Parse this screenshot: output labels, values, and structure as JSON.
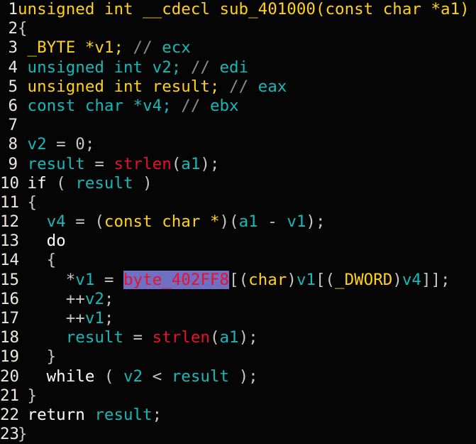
{
  "view": {
    "name": "pseudocode-view",
    "background": "#050505",
    "font_size_px": 22.5,
    "line_height_px": 27.2,
    "total_lines": 23,
    "function_name": "sub_401000",
    "selected_token": "byte_402FF8"
  },
  "colors": {
    "background": "#050505",
    "line_number": "#ede8de",
    "punctuation": "#c6c6c6",
    "keyword": "#ffffff",
    "type": "#ffd11a",
    "variable": "#18b8b8",
    "function_call": "#e8112d",
    "comment": "#8c8c8c",
    "comment_register": "#18b8b8",
    "highlight_background": "#6f6fc4",
    "highlight_text": "#e8112d"
  },
  "lines": [
    {
      "number": "1",
      "tokens": [
        {
          "text": "unsigned int __cdecl sub_401000(const char *a1)",
          "style": "t-type"
        }
      ]
    },
    {
      "number": "2",
      "tokens": [
        {
          "text": "{",
          "style": "t-punct"
        }
      ]
    },
    {
      "number": "3",
      "tokens": [
        {
          "text": " _BYTE *v1;",
          "style": "t-type"
        },
        {
          "text": " // ",
          "style": "t-comment"
        },
        {
          "text": "ecx",
          "style": "t-comreg"
        }
      ]
    },
    {
      "number": "4",
      "tokens": [
        {
          "text": " unsigned int v2;",
          "style": "t-var"
        },
        {
          "text": " // ",
          "style": "t-comment"
        },
        {
          "text": "edi",
          "style": "t-comreg"
        }
      ]
    },
    {
      "number": "5",
      "tokens": [
        {
          "text": " unsigned int result;",
          "style": "t-type"
        },
        {
          "text": " // ",
          "style": "t-comment"
        },
        {
          "text": "eax",
          "style": "t-comreg"
        }
      ]
    },
    {
      "number": "6",
      "tokens": [
        {
          "text": " const char *v4;",
          "style": "t-var"
        },
        {
          "text": " // ",
          "style": "t-comment"
        },
        {
          "text": "ebx",
          "style": "t-comreg"
        }
      ]
    },
    {
      "number": "7",
      "tokens": [
        {
          "text": "",
          "style": "t-plain"
        }
      ]
    },
    {
      "number": "8",
      "tokens": [
        {
          "text": " ",
          "style": "t-plain"
        },
        {
          "text": "v2",
          "style": "t-var"
        },
        {
          "text": " = ",
          "style": "t-punct"
        },
        {
          "text": "0",
          "style": "t-number"
        },
        {
          "text": ";",
          "style": "t-punct"
        }
      ]
    },
    {
      "number": "9",
      "tokens": [
        {
          "text": " ",
          "style": "t-plain"
        },
        {
          "text": "result",
          "style": "t-var"
        },
        {
          "text": " = ",
          "style": "t-punct"
        },
        {
          "text": "strlen",
          "style": "t-func"
        },
        {
          "text": "(",
          "style": "t-punct"
        },
        {
          "text": "a1",
          "style": "t-var"
        },
        {
          "text": ");",
          "style": "t-punct"
        }
      ]
    },
    {
      "number": "10",
      "tokens": [
        {
          "text": " ",
          "style": "t-plain"
        },
        {
          "text": "if",
          "style": "t-keyword"
        },
        {
          "text": " ( ",
          "style": "t-punct"
        },
        {
          "text": "result",
          "style": "t-var"
        },
        {
          "text": " )",
          "style": "t-punct"
        }
      ]
    },
    {
      "number": "11",
      "tokens": [
        {
          "text": " {",
          "style": "t-punct"
        }
      ]
    },
    {
      "number": "12",
      "tokens": [
        {
          "text": "   ",
          "style": "t-plain"
        },
        {
          "text": "v4",
          "style": "t-var"
        },
        {
          "text": " = (",
          "style": "t-punct"
        },
        {
          "text": "const char",
          "style": "t-type"
        },
        {
          "text": " ",
          "style": "t-plain"
        },
        {
          "text": "*",
          "style": "t-type"
        },
        {
          "text": ")(",
          "style": "t-punct"
        },
        {
          "text": "a1",
          "style": "t-var"
        },
        {
          "text": " - ",
          "style": "t-punct"
        },
        {
          "text": "v1",
          "style": "t-var"
        },
        {
          "text": ");",
          "style": "t-punct"
        }
      ]
    },
    {
      "number": "13",
      "tokens": [
        {
          "text": "   ",
          "style": "t-plain"
        },
        {
          "text": "do",
          "style": "t-keyword"
        }
      ]
    },
    {
      "number": "14",
      "tokens": [
        {
          "text": "   {",
          "style": "t-punct"
        }
      ]
    },
    {
      "number": "15",
      "tokens": [
        {
          "text": "     *",
          "style": "t-punct"
        },
        {
          "text": "v1",
          "style": "t-var"
        },
        {
          "text": " = ",
          "style": "t-punct"
        },
        {
          "text": "byte_402FF8",
          "style": "t-highlight"
        },
        {
          "text": "[(",
          "style": "t-punct"
        },
        {
          "text": "char",
          "style": "t-type"
        },
        {
          "text": ")",
          "style": "t-punct"
        },
        {
          "text": "v1",
          "style": "t-var"
        },
        {
          "text": "[(",
          "style": "t-punct"
        },
        {
          "text": "_DWORD",
          "style": "t-type"
        },
        {
          "text": ")",
          "style": "t-punct"
        },
        {
          "text": "v4",
          "style": "t-var"
        },
        {
          "text": "]];",
          "style": "t-punct"
        }
      ]
    },
    {
      "number": "16",
      "tokens": [
        {
          "text": "     ++",
          "style": "t-punct"
        },
        {
          "text": "v2",
          "style": "t-var"
        },
        {
          "text": ";",
          "style": "t-punct"
        }
      ]
    },
    {
      "number": "17",
      "tokens": [
        {
          "text": "     ++",
          "style": "t-punct"
        },
        {
          "text": "v1",
          "style": "t-var"
        },
        {
          "text": ";",
          "style": "t-punct"
        }
      ]
    },
    {
      "number": "18",
      "tokens": [
        {
          "text": "     ",
          "style": "t-plain"
        },
        {
          "text": "result",
          "style": "t-var"
        },
        {
          "text": " = ",
          "style": "t-punct"
        },
        {
          "text": "strlen",
          "style": "t-func"
        },
        {
          "text": "(",
          "style": "t-punct"
        },
        {
          "text": "a1",
          "style": "t-var"
        },
        {
          "text": ");",
          "style": "t-punct"
        }
      ]
    },
    {
      "number": "19",
      "tokens": [
        {
          "text": "   }",
          "style": "t-punct"
        }
      ]
    },
    {
      "number": "20",
      "tokens": [
        {
          "text": "   ",
          "style": "t-plain"
        },
        {
          "text": "while",
          "style": "t-keyword"
        },
        {
          "text": " ( ",
          "style": "t-punct"
        },
        {
          "text": "v2",
          "style": "t-var"
        },
        {
          "text": " < ",
          "style": "t-punct"
        },
        {
          "text": "result",
          "style": "t-var"
        },
        {
          "text": " );",
          "style": "t-punct"
        }
      ]
    },
    {
      "number": "21",
      "tokens": [
        {
          "text": " }",
          "style": "t-punct"
        }
      ]
    },
    {
      "number": "22",
      "tokens": [
        {
          "text": " ",
          "style": "t-plain"
        },
        {
          "text": "return",
          "style": "t-keyword"
        },
        {
          "text": " ",
          "style": "t-plain"
        },
        {
          "text": "result",
          "style": "t-var"
        },
        {
          "text": ";",
          "style": "t-punct"
        }
      ]
    },
    {
      "number": "23",
      "tokens": [
        {
          "text": "}",
          "style": "t-punct"
        }
      ]
    }
  ]
}
